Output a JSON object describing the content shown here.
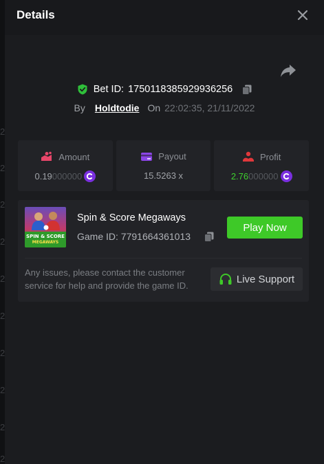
{
  "background": {
    "side_digits": [
      "2",
      "2",
      "2",
      "2",
      "2",
      "2",
      "2",
      "2",
      "2",
      "2",
      "2"
    ]
  },
  "modal": {
    "title": "Details"
  },
  "bet": {
    "id_label": "Bet ID:",
    "id": "1750118385929936256",
    "by_label": "By",
    "user": "Holdtodie",
    "on_label": "On",
    "datetime": "22:02:35, 21/11/2022"
  },
  "stats": {
    "amount": {
      "label": "Amount",
      "value_main": "0.19",
      "value_dim": "000000"
    },
    "payout": {
      "label": "Payout",
      "value": "15.5263 x"
    },
    "profit": {
      "label": "Profit",
      "value_main": "2.76",
      "value_dim": "000000"
    }
  },
  "game": {
    "name": "Spin & Score Megaways",
    "id_label": "Game ID:",
    "id": "7791664361013",
    "thumb_text_1": "SPIN & SCORE",
    "thumb_text_2": "MEGAWAYS",
    "play_label": "Play Now"
  },
  "support": {
    "help_text": "Any issues, please contact the customer service for help and provide the game ID.",
    "button_label": "Live Support"
  },
  "colors": {
    "accent_green": "#3ec928",
    "coin_purple": "#7a2fe0",
    "amount_icon": "#e8466a",
    "payout_icon": "#8b45e6",
    "profit_icon": "#e0383b"
  },
  "icons": {
    "close": "close-icon",
    "share": "share-icon",
    "shield": "shield-check-icon",
    "copy": "copy-icon",
    "coin": "coin-icon",
    "headset": "headset-icon"
  }
}
